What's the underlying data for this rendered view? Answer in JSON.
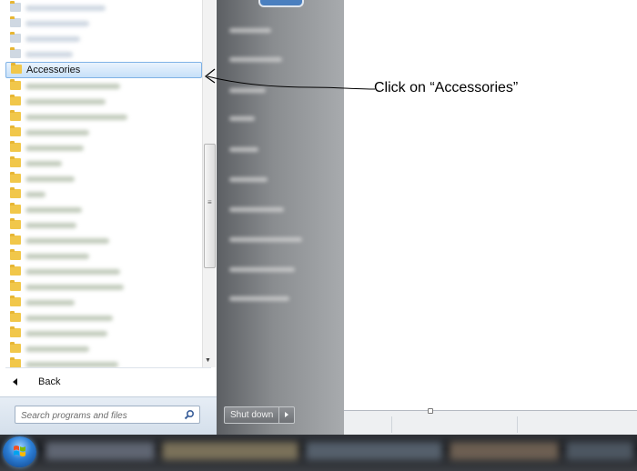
{
  "start_menu": {
    "programs": [
      {
        "label": "",
        "state": "faded",
        "icon": "app-icon"
      },
      {
        "label": "",
        "state": "faded",
        "icon": "app-icon"
      },
      {
        "label": "",
        "state": "faded",
        "icon": "app-icon"
      },
      {
        "label": "",
        "state": "faded",
        "icon": "app-icon"
      },
      {
        "label": "Accessories",
        "state": "selected",
        "icon": "folder-icon"
      },
      {
        "label": "",
        "state": "blurred",
        "icon": "folder-icon"
      },
      {
        "label": "",
        "state": "blurred",
        "icon": "folder-icon"
      },
      {
        "label": "",
        "state": "blurred",
        "icon": "folder-icon"
      },
      {
        "label": "",
        "state": "blurred",
        "icon": "folder-icon"
      },
      {
        "label": "",
        "state": "blurred",
        "icon": "folder-icon"
      },
      {
        "label": "",
        "state": "blurred",
        "icon": "folder-icon"
      },
      {
        "label": "",
        "state": "blurred",
        "icon": "folder-icon"
      },
      {
        "label": "",
        "state": "blurred",
        "icon": "folder-icon"
      },
      {
        "label": "",
        "state": "blurred",
        "icon": "folder-icon"
      },
      {
        "label": "",
        "state": "blurred",
        "icon": "folder-icon"
      },
      {
        "label": "",
        "state": "blurred",
        "icon": "folder-icon"
      },
      {
        "label": "",
        "state": "blurred",
        "icon": "folder-icon"
      },
      {
        "label": "",
        "state": "blurred",
        "icon": "folder-icon"
      },
      {
        "label": "",
        "state": "blurred",
        "icon": "folder-icon"
      },
      {
        "label": "",
        "state": "blurred",
        "icon": "folder-icon"
      },
      {
        "label": "",
        "state": "blurred",
        "icon": "folder-icon"
      },
      {
        "label": "",
        "state": "blurred",
        "icon": "folder-icon"
      },
      {
        "label": "",
        "state": "blurred",
        "icon": "folder-icon"
      },
      {
        "label": "",
        "state": "blurred",
        "icon": "folder-icon"
      }
    ],
    "back_label": "Back",
    "search": {
      "placeholder": "Search programs and files"
    },
    "shutdown_label": "Shut down"
  },
  "annotation": {
    "text": "Click on “Accessories”"
  },
  "colors": {
    "selection_border": "#7fb2e6",
    "folder": "#f1c74a",
    "right_pane": "#8a8d90",
    "taskbar": "#1a1c20"
  }
}
